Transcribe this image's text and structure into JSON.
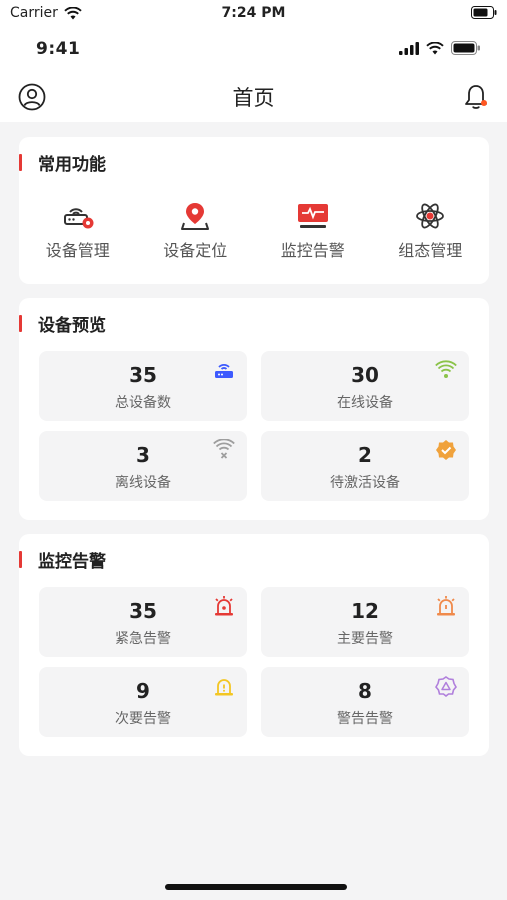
{
  "system": {
    "carrier": "Carrier",
    "time": "7:24 PM"
  },
  "app_status": {
    "time": "9:41"
  },
  "nav": {
    "title": "首页"
  },
  "common_functions": {
    "title": "常用功能",
    "items": [
      {
        "label": "设备管理",
        "icon": "router-gear-icon"
      },
      {
        "label": "设备定位",
        "icon": "location-pin-icon"
      },
      {
        "label": "监控告警",
        "icon": "monitor-pulse-icon"
      },
      {
        "label": "组态管理",
        "icon": "atom-icon"
      }
    ]
  },
  "device_overview": {
    "title": "设备预览",
    "tiles": [
      {
        "value": "35",
        "label": "总设备数",
        "icon": "router-icon"
      },
      {
        "value": "30",
        "label": "在线设备",
        "icon": "wifi-icon"
      },
      {
        "value": "3",
        "label": "离线设备",
        "icon": "wifi-off-icon"
      },
      {
        "value": "2",
        "label": "待激活设备",
        "icon": "verified-badge-icon"
      }
    ]
  },
  "alarms": {
    "title": "监控告警",
    "tiles": [
      {
        "value": "35",
        "label": "紧急告警",
        "icon": "siren-icon"
      },
      {
        "value": "12",
        "label": "主要告警",
        "icon": "bell-alert-icon"
      },
      {
        "value": "9",
        "label": "次要告警",
        "icon": "bell-minor-icon"
      },
      {
        "value": "8",
        "label": "警告告警",
        "icon": "warning-cloud-icon"
      }
    ]
  },
  "colors": {
    "accent_red": "#e53935",
    "router_blue": "#3d5afe",
    "online_green": "#8bc34a",
    "offline_gray": "#9e9e9e",
    "pending_orange": "#f0a23c",
    "urgent_red": "#e53935",
    "major_orange": "#f08a4b",
    "minor_yellow": "#f3c623",
    "warning_purple": "#b07fdc"
  }
}
